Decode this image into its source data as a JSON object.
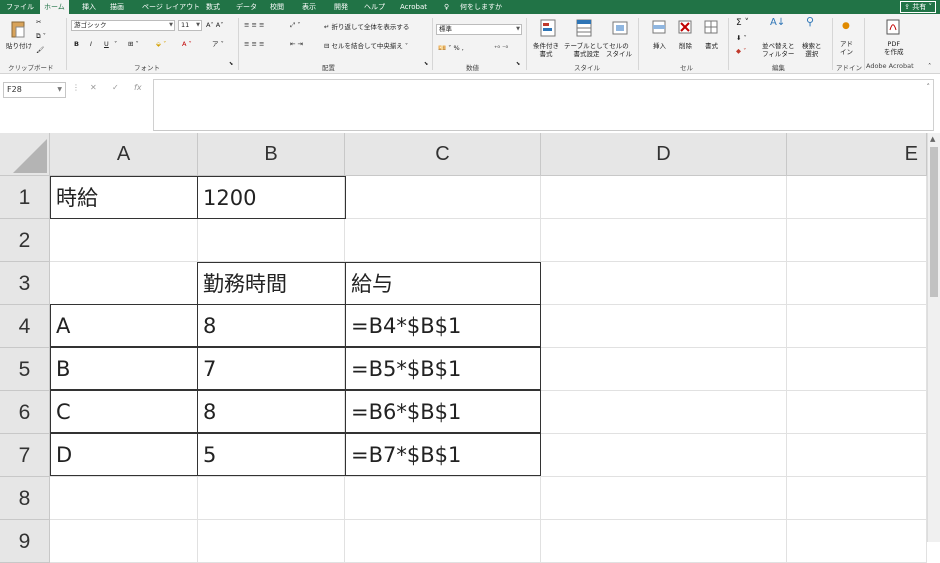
{
  "tabs": [
    "ファイル",
    "ホーム",
    "挿入",
    "描画",
    "ページ レイアウト",
    "数式",
    "データ",
    "校閲",
    "表示",
    "開発",
    "ヘルプ",
    "Acrobat"
  ],
  "active_tab": "ホーム",
  "tell_me": "何をしますか",
  "share_label": "共有",
  "ribbon": {
    "clipboard": {
      "paste": "貼り付け",
      "label": "クリップボード"
    },
    "font": {
      "name": "游ゴシック",
      "size": "11",
      "bold": "B",
      "italic": "I",
      "underline": "U",
      "label": "フォント"
    },
    "alignment": {
      "wrap": "折り返して全体を表示する",
      "merge": "セルを結合して中央揃え",
      "label": "配置"
    },
    "number": {
      "format": "標準",
      "label": "数値"
    },
    "styles": {
      "conditional": "条件付き\n書式",
      "table": "テーブルとして\n書式設定",
      "cell": "セルの\nスタイル",
      "label": "スタイル"
    },
    "cells": {
      "insert": "挿入",
      "delete": "削除",
      "format": "書式",
      "label": "セル"
    },
    "editing": {
      "sort": "並べ替えと\nフィルター",
      "find": "検索と\n選択",
      "label": "編集"
    },
    "addins": {
      "name": "アド\nイン",
      "label": "アドイン"
    },
    "acrobat": {
      "pdf": "PDF\nを作成",
      "label": "Adobe Acrobat"
    }
  },
  "name_box": "F28",
  "formula_value": "",
  "columns": [
    "A",
    "B",
    "C",
    "D",
    "E"
  ],
  "rows": [
    "1",
    "2",
    "3",
    "4",
    "5",
    "6",
    "7",
    "8",
    "9"
  ],
  "cells": {
    "A1": "時給",
    "B1": "1200",
    "B3": "勤務時間",
    "C3": "給与",
    "A4": "A",
    "B4": "8",
    "C4": "=B4*$B$1",
    "A5": "B",
    "B5": "7",
    "C5": "=B5*$B$1",
    "A6": "C",
    "B6": "8",
    "C6": "=B6*$B$1",
    "A7": "D",
    "B7": "5",
    "C7": "=B7*$B$1"
  },
  "colors": {
    "brand": "#217346",
    "header_bg": "#e6e6e6",
    "grid_line": "#e1e1e1"
  }
}
